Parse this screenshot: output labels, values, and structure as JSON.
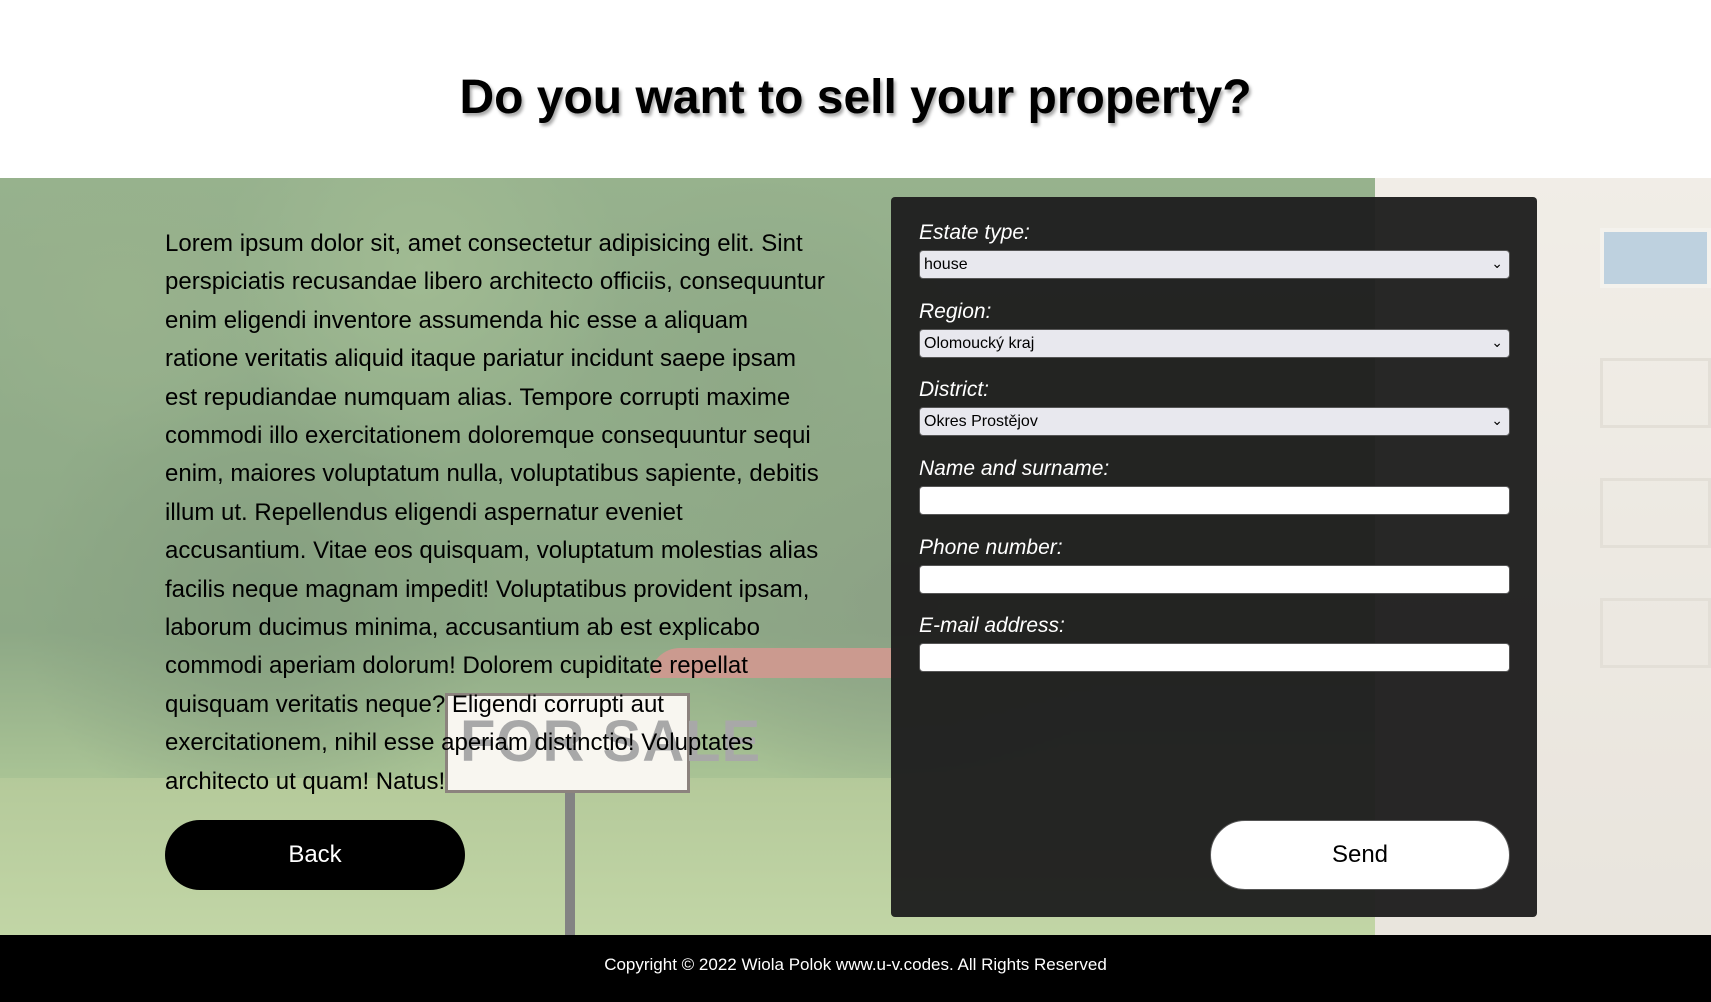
{
  "header": {
    "title": "Do you want to sell your property?"
  },
  "intro": {
    "text": "Lorem ipsum dolor sit, amet consectetur adipisicing elit. Sint perspiciatis recusandae libero architecto officiis, consequuntur enim eligendi inventore assumenda hic esse a aliquam ratione veritatis aliquid itaque pariatur incidunt saepe ipsam est repudiandae numquam alias. Tempore corrupti maxime commodi illo exercitationem doloremque consequuntur sequi enim, maiores voluptatum nulla, voluptatibus sapiente, debitis illum ut. Repellendus eligendi aspernatur eveniet accusantium. Vitae eos quisquam, voluptatum molestias alias facilis neque magnam impedit! Voluptatibus provident ipsam, laborum ducimus minima, accusantium ab est explicabo commodi aperiam dolorum! Dolorem cupiditate repellat quisquam veritatis neque? Eligendi corrupti aut exercitationem, nihil esse aperiam distinctio! Voluptates architecto ut quam! Natus!",
    "back_label": "Back"
  },
  "background": {
    "sign_text": "FOR SALE"
  },
  "form": {
    "estate_type": {
      "label": "Estate type:",
      "value": "house"
    },
    "region": {
      "label": "Region:",
      "value": "Olomoucký kraj"
    },
    "district": {
      "label": "District:",
      "value": "Okres Prostějov"
    },
    "name": {
      "label": "Name and surname:",
      "value": ""
    },
    "phone": {
      "label": "Phone number:",
      "value": ""
    },
    "email": {
      "label": "E-mail address:",
      "value": ""
    },
    "send_label": "Send"
  },
  "footer": {
    "text": "Copyright © 2022 Wiola Polok www.u-v.codes. All Rights Reserved"
  },
  "colors": {
    "panel": "#1e1e1e",
    "footer": "#000000",
    "button_dark": "#000000",
    "button_light": "#ffffff"
  },
  "icons": {
    "select_arrow": "chevron-down-icon"
  }
}
